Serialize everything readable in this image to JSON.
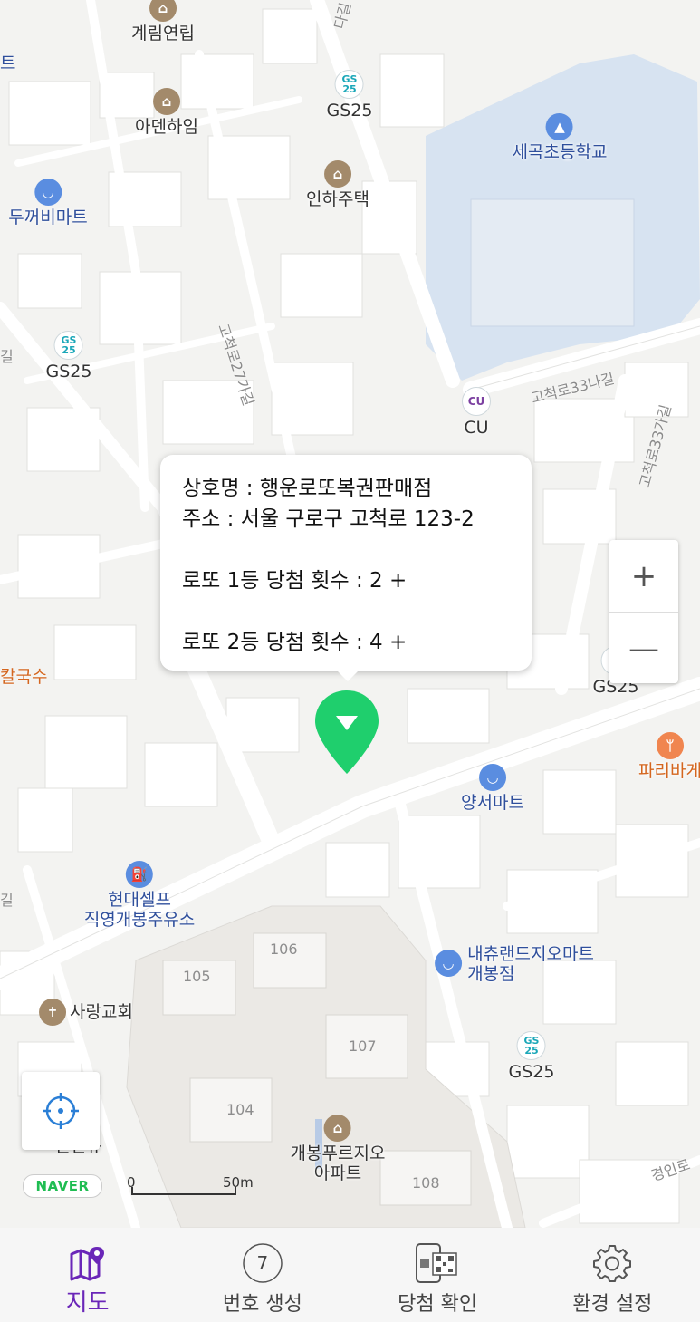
{
  "map": {
    "pois": [
      {
        "name": "계림연립",
        "icon": "house-icon",
        "color": "brown"
      },
      {
        "name": "아덴하임",
        "icon": "house-icon",
        "color": "brown"
      },
      {
        "name": "GS25",
        "icon": "gs25-icon",
        "color": "gs"
      },
      {
        "name": "인하주택",
        "icon": "house-icon",
        "color": "brown"
      },
      {
        "name": "세곡초등학교",
        "icon": "school-icon",
        "color": "blue"
      },
      {
        "name": "두꺼비마트",
        "icon": "basket-icon",
        "color": "blue"
      },
      {
        "name": "GS25",
        "icon": "gs25-icon",
        "color": "gs"
      },
      {
        "name": "CU",
        "icon": "cu-icon",
        "color": "cu"
      },
      {
        "name": "GS25",
        "icon": "gs25-icon",
        "color": "gs"
      },
      {
        "name": "파리바게",
        "icon": "restaurant-icon",
        "color": "orange"
      },
      {
        "name": "양서마트",
        "icon": "basket-icon",
        "color": "blue"
      },
      {
        "name": "현대셀프\n직영개봉주유소",
        "icon": "gas-station-icon",
        "color": "blue"
      },
      {
        "name": "사랑교회",
        "icon": "church-icon",
        "color": "brown"
      },
      {
        "name": "내츄랜드지오마트\n개봉점",
        "icon": "basket-icon",
        "color": "blue"
      },
      {
        "name": "GS25",
        "icon": "gs25-icon",
        "color": "gs"
      },
      {
        "name": "개봉푸르지오\n아파트",
        "icon": "house-icon",
        "color": "brown"
      }
    ],
    "partial_labels": {
      "left_top": "트",
      "left_kalguksu": "칼국수",
      "left_gil": "길",
      "left_gil2": "길",
      "bottom_partial": "신면규",
      "bottom_right": "경인로"
    },
    "roads": {
      "r1": "고척로27가길",
      "r2": "고척로33나길",
      "r3": "고척로33가길",
      "r4": "다길"
    },
    "buildings": {
      "b1": "106",
      "b2": "105",
      "b3": "107",
      "b4": "104",
      "b5": "108"
    },
    "scale": {
      "zero": "0",
      "fifty": "50m"
    },
    "naver_logo": "NAVER"
  },
  "popup": {
    "line1": "상호명 : 행운로또복권판매점",
    "line2": "주소 : 서울 구로구 고척로 123-2",
    "line3": "로또 1등 당첨 횟수 :  2 +",
    "line4": "로또 2등 당첨 횟수 :  4 +"
  },
  "zoom": {
    "plus": "+",
    "minus": "—"
  },
  "nav": {
    "tabs": [
      {
        "label": "지도",
        "active": true
      },
      {
        "label": "번호 생성",
        "badge": "7"
      },
      {
        "label": "당첨 확인"
      },
      {
        "label": "환경 설정"
      }
    ],
    "active_color": "#6a26b8"
  },
  "colors": {
    "pin": "#1fcf6d",
    "school_area": "#d6e2f0"
  }
}
